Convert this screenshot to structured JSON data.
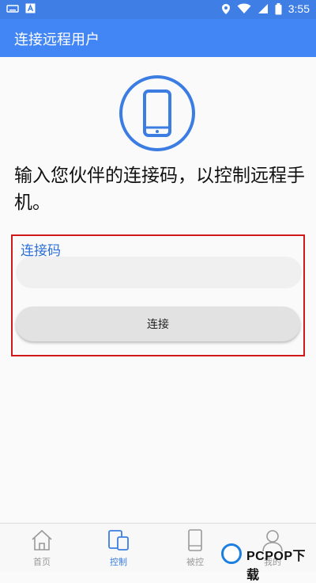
{
  "status_bar": {
    "time": "3:55",
    "left_icons": [
      "keyboard-icon",
      "notification-a-icon"
    ],
    "right_icons": [
      "location-icon",
      "wifi-icon",
      "signal-icon",
      "battery-icon"
    ]
  },
  "app_bar": {
    "title": "连接远程用户"
  },
  "main": {
    "instruction": "输入您伙伴的连接码，以控制远程手机。",
    "code_label": "连接码",
    "code_value": "",
    "connect_label": "连接"
  },
  "bottom_nav": {
    "items": [
      {
        "label": "首页",
        "icon": "home-icon",
        "active": false
      },
      {
        "label": "控制",
        "icon": "control-devices-icon",
        "active": true
      },
      {
        "label": "被控",
        "icon": "phone-icon",
        "active": false
      },
      {
        "label": "我的",
        "icon": "user-icon",
        "active": false
      }
    ]
  },
  "colors": {
    "accent": "#4285f4",
    "highlight_border": "#d01a1a",
    "active_tab": "#3b7de2"
  },
  "watermark": {
    "text": "PCPOP下载"
  }
}
